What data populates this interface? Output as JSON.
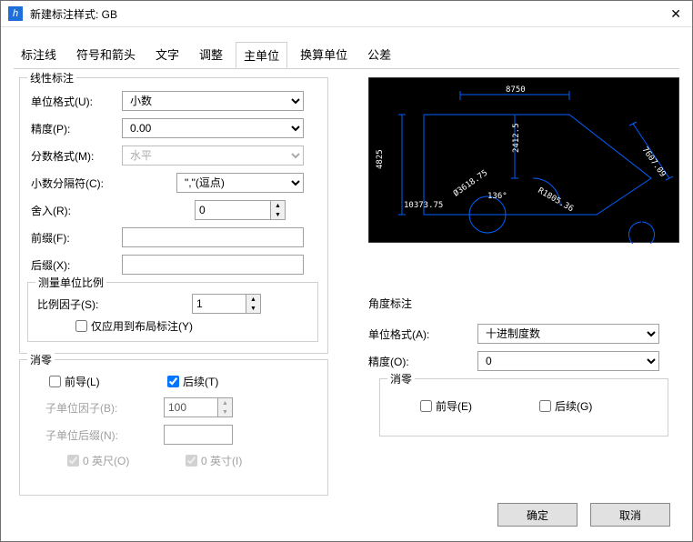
{
  "window": {
    "title": "新建标注样式: GB"
  },
  "tabs": {
    "t1": "标注线",
    "t2": "符号和箭头",
    "t3": "文字",
    "t4": "调整",
    "t5": "主单位",
    "t6": "换算单位",
    "t7": "公差"
  },
  "linear": {
    "legend": "线性标注",
    "unit_format_label": "单位格式(U):",
    "unit_format": "小数",
    "precision_label": "精度(P):",
    "precision": "0.00",
    "fraction_label": "分数格式(M):",
    "fraction": "水平",
    "decimal_sep_label": "小数分隔符(C):",
    "decimal_sep": "\",\"(逗点)",
    "roundoff_label": "舍入(R):",
    "roundoff": "0",
    "prefix_label": "前缀(F):",
    "prefix": "",
    "suffix_label": "后缀(X):",
    "suffix": "",
    "scale_legend": "测量单位比例",
    "scale_factor_label": "比例因子(S):",
    "scale_factor": "1",
    "layout_only": "仅应用到布局标注(Y)",
    "zero_legend": "消零",
    "leading": "前导(L)",
    "trailing": "后续(T)",
    "sub_factor_label": "子单位因子(B):",
    "sub_factor": "100",
    "sub_suffix_label": "子单位后缀(N):",
    "feet": "0 英尺(O)",
    "inch": "0 英寸(I)"
  },
  "angle": {
    "legend": "角度标注",
    "unit_format_label": "单位格式(A):",
    "unit_format": "十进制度数",
    "precision_label": "精度(O):",
    "precision": "0",
    "zero_legend": "消零",
    "leading": "前导(E)",
    "trailing": "后续(G)"
  },
  "preview": {
    "d1": "8750",
    "d2": "4825",
    "d3": "2412.5",
    "d4": "R1805.36",
    "d5": "10373.75",
    "d6": "Ø3618.75",
    "d7": "136°",
    "d8": "7607.09"
  },
  "buttons": {
    "ok": "确定",
    "cancel": "取消"
  }
}
